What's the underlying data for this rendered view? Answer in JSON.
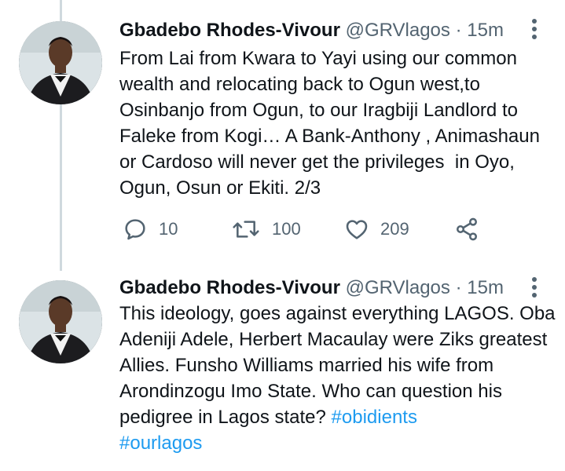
{
  "tweets": [
    {
      "author_name": "Gbadebo Rhodes-Vivour",
      "handle": "@GRVlagos",
      "separator": "·",
      "time": "15m",
      "text": "From Lai from Kwara to Yayi using our common wealth and relocating back to Ogun west,to Osinbanjo from Ogun, to our Iragbiji Landlord to Faleke from Kogi… A Bank-Anthony , Animashaun or Cardoso will never get the privileges  in Oyo, Ogun, Osun or Ekiti. 2/3",
      "replies": "10",
      "retweets": "100",
      "likes": "209"
    },
    {
      "author_name": "Gbadebo Rhodes-Vivour",
      "handle": "@GRVlagos",
      "separator": "·",
      "time": "15m",
      "text": "This ideology, goes against everything LAGOS. Oba Adeniji Adele, Herbert Macaulay were Ziks greatest Allies. Funsho Williams married his wife from Arondinzogu Imo State. Who can question his pedigree in Lagos state?",
      "hashtags": [
        "#obidients",
        "#ourlagos"
      ]
    }
  ],
  "colors": {
    "text": "#0f1419",
    "muted": "#536471",
    "link": "#1d9bf0",
    "thread_line": "#cfd9de"
  },
  "icons": [
    "avatar",
    "more-icon",
    "reply-icon",
    "retweet-icon",
    "like-icon",
    "share-icon"
  ]
}
